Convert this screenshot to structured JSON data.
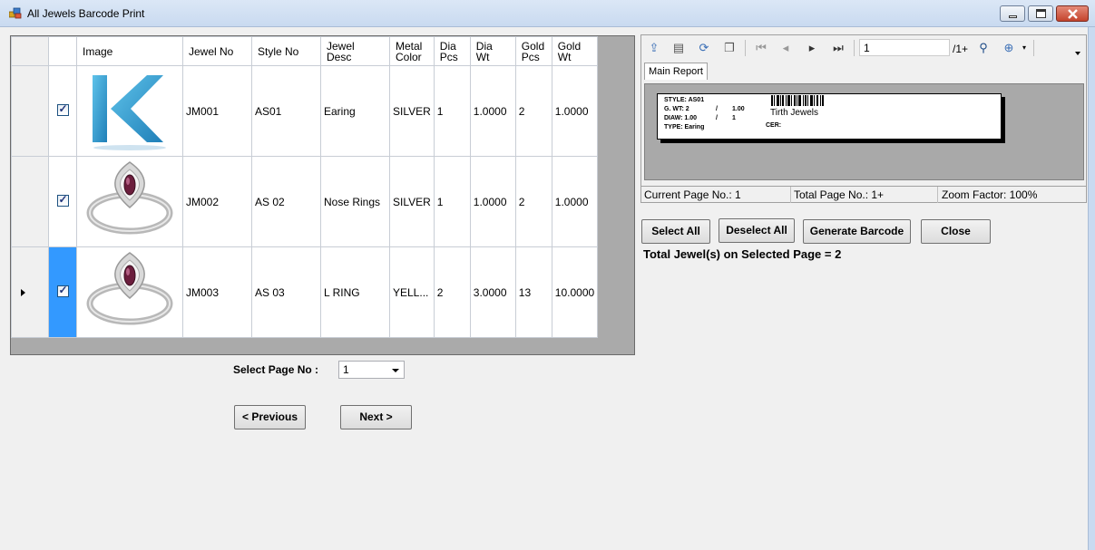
{
  "window": {
    "title": "All Jewels Barcode Print"
  },
  "grid": {
    "columns": [
      "",
      "Image",
      "Jewel No",
      "Style No",
      "Jewel\nDesc",
      "Metal\nColor",
      "Dia\nPcs",
      "Dia\nWt",
      "Gold\nPcs",
      "Gold\nWt"
    ],
    "rows": [
      {
        "checked": true,
        "image": "k-logo",
        "jewel_no": "JM001",
        "style_no": "AS01",
        "jewel_desc": "Earing",
        "metal_color": "SILVER",
        "dia_pcs": "1",
        "dia_wt": "1.0000",
        "gold_pcs": "2",
        "gold_wt": "1.0000"
      },
      {
        "checked": true,
        "image": "ring",
        "jewel_no": "JM002",
        "style_no": "AS 02",
        "jewel_desc": "Nose Rings",
        "metal_color": "SILVER",
        "dia_pcs": "1",
        "dia_wt": "1.0000",
        "gold_pcs": "2",
        "gold_wt": "1.0000"
      },
      {
        "checked": true,
        "image": "ring",
        "jewel_no": "JM003",
        "style_no": "AS 03",
        "jewel_desc": "L RING",
        "metal_color": "YELL...",
        "dia_pcs": "2",
        "dia_wt": "3.0000",
        "gold_pcs": "13",
        "gold_wt": "10.0000"
      }
    ]
  },
  "pager": {
    "label": "Select Page No :",
    "selected": "1",
    "prev_label": "< Previous",
    "next_label": "Next >"
  },
  "viewer": {
    "page_input": "1",
    "page_total": "/1+",
    "tab_label": "Main Report",
    "label": {
      "style": "STYLE: AS01",
      "gwt": "G. WT:  2",
      "gwt_sep": "/",
      "gwt_v2": "1.00",
      "diaw": "DIAW:  1.00",
      "diaw_sep": "/",
      "diaw_v2": "1",
      "type": "TYPE:  Earing",
      "cer": "CER:",
      "shop": "Tirth Jewels"
    },
    "status": {
      "current": "Current Page No.: 1",
      "total": "Total Page No.: 1+",
      "zoom": "Zoom Factor: 100%"
    }
  },
  "actions": {
    "select_all": "Select All",
    "deselect_all": "Deselect All",
    "generate": "Generate Barcode",
    "close": "Close"
  },
  "summary": {
    "total": "Total Jewel(s) on Selected Page = 2"
  },
  "colors": {
    "selection": "#3399ff",
    "grid_bg": "#aaaaaa"
  }
}
